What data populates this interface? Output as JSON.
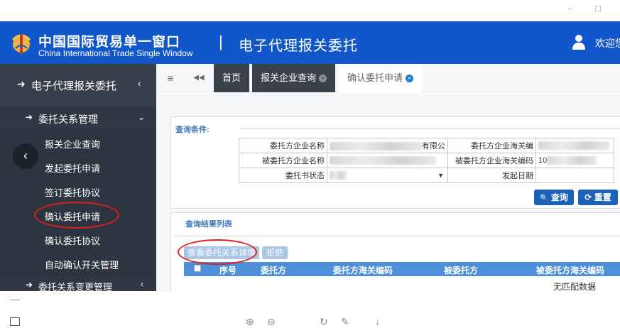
{
  "window": {
    "minimize": "-",
    "maximize": "□"
  },
  "header": {
    "title_cn": "中国国际贸易单一窗口",
    "title_en": "China International Trade Single Window",
    "separator": "|",
    "system_name": "电子代理报关委托",
    "welcome": "欢迎您",
    "brand_color": "#1257c9"
  },
  "sidebar": {
    "top": {
      "label": "电子代理报关委托",
      "arrow": "➜",
      "chevron": "‹"
    },
    "section": {
      "label": "委托关系管理",
      "arrow": "➜",
      "chevron": "⌄"
    },
    "items": [
      {
        "label": "报关企业查询"
      },
      {
        "label": "发起委托申请"
      },
      {
        "label": "签订委托协议"
      },
      {
        "label": "确认委托申请"
      },
      {
        "label": "确认委托协议"
      },
      {
        "label": "自动确认开关管理"
      }
    ],
    "bottom": {
      "label": "委托关系变更管理",
      "arrow": "➜",
      "chevron": "‹"
    },
    "collapse": "‹"
  },
  "tabbar": {
    "menu_icon": "≡",
    "back_icon": "◀◀",
    "tabs": [
      {
        "label": "首页"
      },
      {
        "label": "报关企业查询",
        "close": "×"
      },
      {
        "label": "确认委托申请",
        "close": "×"
      }
    ]
  },
  "query": {
    "legend": "查询条件:",
    "fields": {
      "client_name": "委托方企业名称",
      "client_name_value_tail": "有限公",
      "client_code": "委托方企业海关编",
      "trustee_name": "被委托方企业名称",
      "trustee_code": "被委托方企业海关编码",
      "trustee_code_value": "10",
      "status": "委托书状态",
      "status_arrow": "▼",
      "start_date": "发起日期"
    },
    "search_button": "查询",
    "reset_button": "重置",
    "search_icon": "🔍",
    "reset_icon": "⟳"
  },
  "results": {
    "legend": "查询结果列表",
    "view_button": "查看委托关系详情",
    "reject_button": "拒绝",
    "columns": [
      "序号",
      "委托方",
      "委托方海关编码",
      "被委托方",
      "被委托方海关编码"
    ],
    "empty": "无匹配数据"
  },
  "bottom_toolbar": {
    "zoom_in": "⊕",
    "zoom_out": "⊖",
    "refresh": "↻",
    "edit": "✎",
    "download": "↓"
  }
}
